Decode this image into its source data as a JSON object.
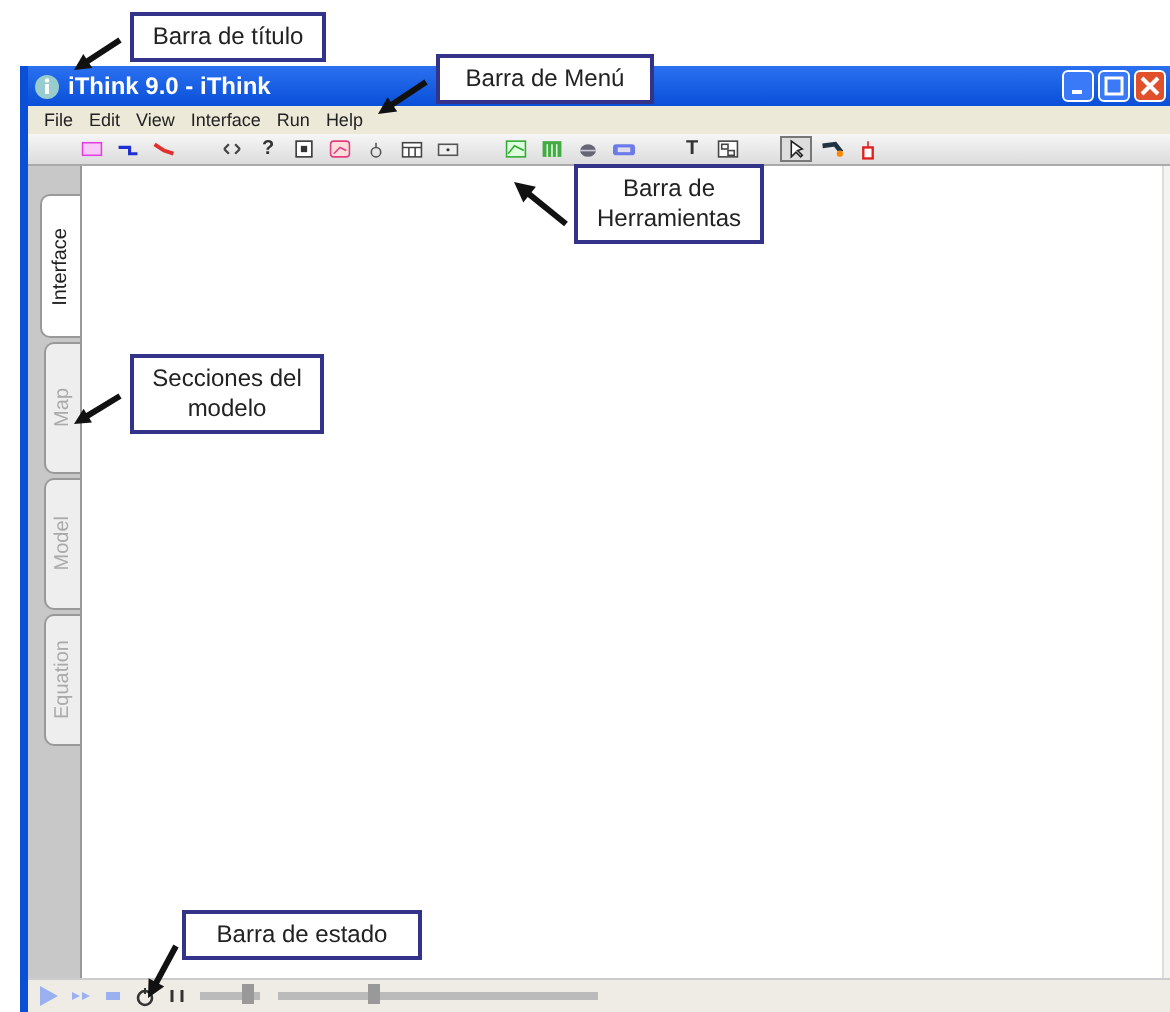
{
  "window": {
    "title": "iThink 9.0 - iThink"
  },
  "menu": [
    "File",
    "Edit",
    "View",
    "Interface",
    "Run",
    "Help"
  ],
  "toolbar": [
    [
      {
        "kind": "stock"
      },
      {
        "kind": "flow"
      },
      {
        "kind": "connector"
      }
    ],
    [
      {
        "kind": "loop"
      },
      {
        "kind": "glyph",
        "text": "?"
      },
      {
        "kind": "button"
      },
      {
        "kind": "graph"
      },
      {
        "kind": "knob"
      },
      {
        "kind": "table"
      },
      {
        "kind": "numeric"
      }
    ],
    [
      {
        "kind": "graphpad"
      },
      {
        "kind": "tablepad"
      },
      {
        "kind": "dial"
      },
      {
        "kind": "slider"
      }
    ],
    [
      {
        "kind": "glyph",
        "text": "T"
      },
      {
        "kind": "picture"
      }
    ],
    [
      {
        "kind": "pointer",
        "selected": true
      },
      {
        "kind": "brush",
        "selected": false
      },
      {
        "kind": "dynamite",
        "selected": false
      }
    ]
  ],
  "tabs": [
    {
      "label": "Interface",
      "selected": true
    },
    {
      "label": "Map",
      "selected": false
    },
    {
      "label": "Model",
      "selected": false
    },
    {
      "label": "Equation",
      "selected": false
    }
  ],
  "status_bar": {
    "sliders": [
      {
        "level": 0.8
      },
      {
        "level": 0.3
      }
    ]
  },
  "callouts": [
    "Barra de título",
    "Barra de Menú",
    "Barra de Herramientas",
    "Secciones del modelo",
    "Barra de estado"
  ]
}
